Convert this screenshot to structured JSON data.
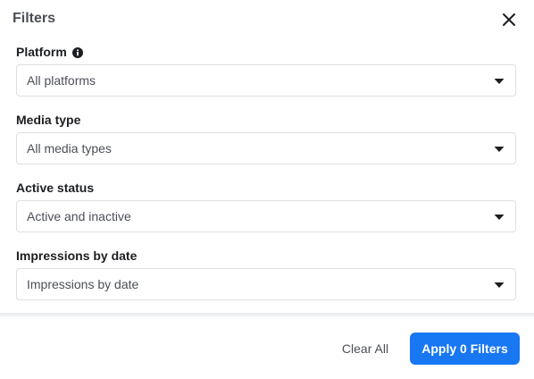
{
  "dialog": {
    "title": "Filters"
  },
  "fields": [
    {
      "label": "Platform",
      "value": "All platforms",
      "has_info": true
    },
    {
      "label": "Media type",
      "value": "All media types",
      "has_info": false
    },
    {
      "label": "Active status",
      "value": "Active and inactive",
      "has_info": false
    },
    {
      "label": "Impressions by date",
      "value": "Impressions by date",
      "has_info": false
    }
  ],
  "footer": {
    "clear_label": "Clear All",
    "apply_label": "Apply 0 Filters"
  },
  "colors": {
    "accent": "#1877f2",
    "text": "#1c1e21",
    "muted_text": "#4b4f56",
    "border": "#dddfe2"
  },
  "icons": {
    "close": "close-icon",
    "info": "info-icon",
    "dropdown": "caret-down-icon"
  }
}
